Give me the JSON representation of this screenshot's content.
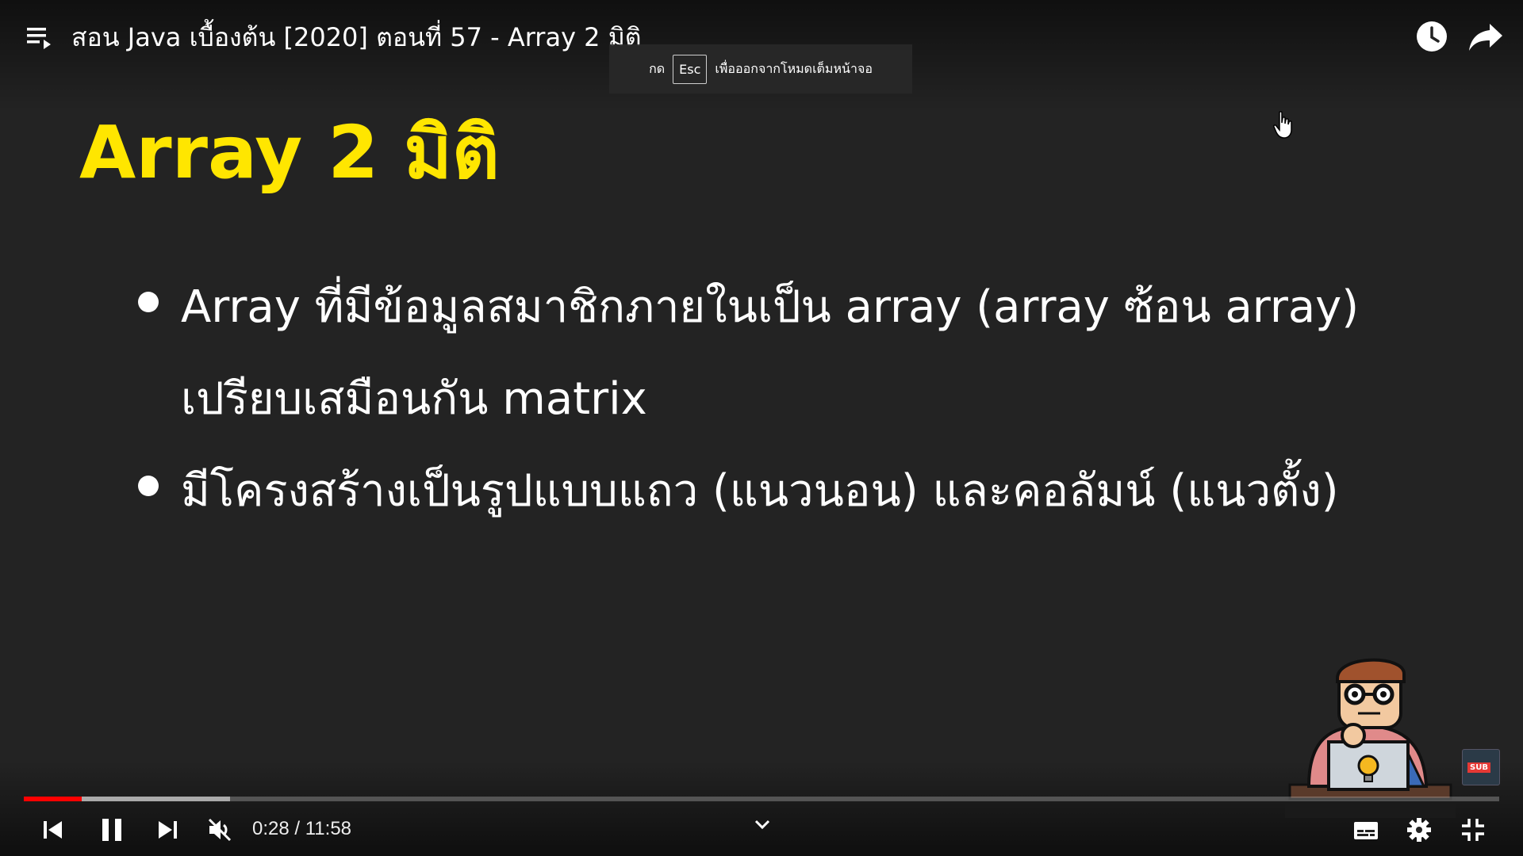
{
  "player": {
    "title": "สอน Java เบื้องต้น [2020] ตอนที่ 57 - Array 2 มิติ",
    "esc_toast": {
      "prefix": "กด",
      "key": "Esc",
      "suffix": "เพื่อออกจากโหมดเต็มหน้าจอ"
    },
    "time": {
      "current": "0:28",
      "separator": " / ",
      "duration": "11:58"
    },
    "progress": {
      "played_fraction": 0.039,
      "buffered_fraction": 0.14
    },
    "accent_color": "#ff0000",
    "icons": {
      "playlist": "playlist-icon",
      "watch_later": "clock-icon",
      "share": "share-icon",
      "previous": "skip-previous-icon",
      "pause": "pause-icon",
      "next": "skip-next-icon",
      "mute": "volume-muted-icon",
      "expand": "chevron-down-icon",
      "subtitles": "subtitles-icon",
      "settings": "gear-icon",
      "exit_fullscreen": "exit-fullscreen-icon"
    }
  },
  "slide": {
    "title": "Array 2 มิติ",
    "title_color": "#ffe600",
    "bullets": [
      {
        "lines": [
          "Array ที่มีข้อมูลสมาชิกภายในเป็น array (array ซ้อน array)",
          "เปรียบเสมือนกัน matrix"
        ]
      },
      {
        "lines": [
          "มีโครงสร้างเป็นรูปแบบแถว (แนวนอน) และคอลัมน์ (แนวตั้ง)"
        ]
      }
    ]
  },
  "watermark": {
    "badge_label": "SUB"
  }
}
